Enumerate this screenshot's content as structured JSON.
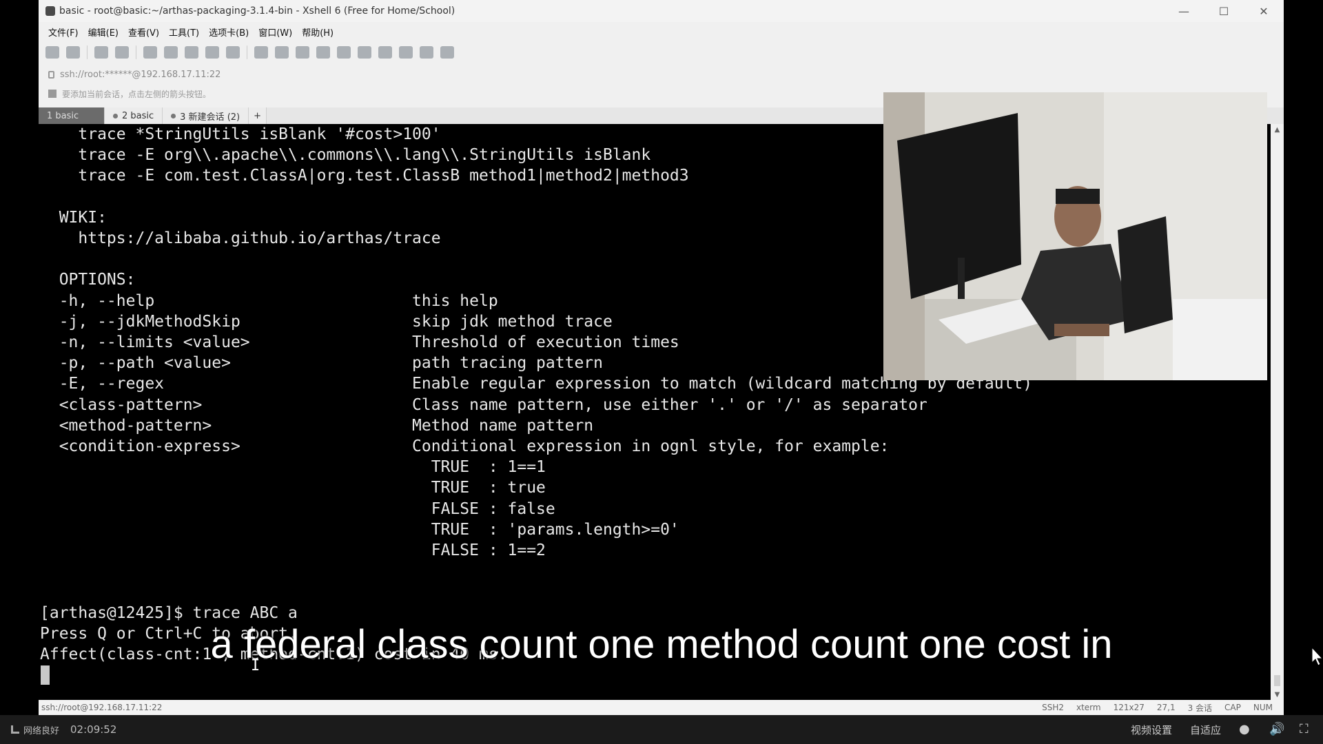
{
  "window": {
    "title": "basic - root@basic:~/arthas-packaging-3.1.4-bin - Xshell 6 (Free for Home/School)",
    "close_glyph": "✕"
  },
  "menu": [
    "文件(F)",
    "编辑(E)",
    "查看(V)",
    "工具(T)",
    "选项卡(B)",
    "窗口(W)",
    "帮助(H)"
  ],
  "address": "ssh://root:******@192.168.17.11:22",
  "hint": "要添加当前会话，点击左侧的箭头按钮。",
  "tabs": [
    {
      "label": "1 basic",
      "active": true
    },
    {
      "label": "2 basic",
      "active": false
    },
    {
      "label": "3 新建会话 (2)",
      "active": false
    },
    {
      "label": "+",
      "active": false
    }
  ],
  "terminal": {
    "lines": [
      "    trace *StringUtils isBlank '#cost>100'",
      "    trace -E org\\\\.apache\\\\.commons\\\\.lang\\\\.StringUtils isBlank",
      "    trace -E com.test.ClassA|org.test.ClassB method1|method2|method3",
      "",
      "  WIKI:",
      "    https://alibaba.github.io/arthas/trace",
      "",
      "  OPTIONS:",
      "  -h, --help                           this help",
      "  -j, --jdkMethodSkip                  skip jdk method trace",
      "  -n, --limits <value>                 Threshold of execution times",
      "  -p, --path <value>                   path tracing pattern",
      "  -E, --regex                          Enable regular expression to match (wildcard matching by default)",
      "  <class-pattern>                      Class name pattern, use either '.' or '/' as separator",
      "  <method-pattern>                     Method name pattern",
      "  <condition-express>                  Conditional expression in ognl style, for example:",
      "                                         TRUE  : 1==1",
      "                                         TRUE  : true",
      "                                         FALSE : false",
      "                                         TRUE  : 'params.length>=0'",
      "                                         FALSE : 1==2",
      "",
      "",
      "[arthas@12425]$ trace ABC a",
      "Press Q or Ctrl+C to abort.",
      "Affect(class-cnt:1 , method-cnt:1) cost in 40 ms."
    ]
  },
  "statusbar": {
    "left": "ssh://root@192.168.17.11:22",
    "protocol": "SSH2",
    "term": "xterm",
    "size": "121x27",
    "position": "27,1",
    "sessions": "3 会话",
    "caps": "CAP",
    "num": "NUM"
  },
  "subtitle": "a federal class count one method count one cost in",
  "player": {
    "network_label": "网络良好",
    "time": "02:09:52",
    "settings_label": "视频设置",
    "fit_label": "自适应"
  },
  "colors": {
    "terminal_bg": "#000000",
    "terminal_fg": "#e8e8e8",
    "active_tab": "#6b6b6b"
  }
}
